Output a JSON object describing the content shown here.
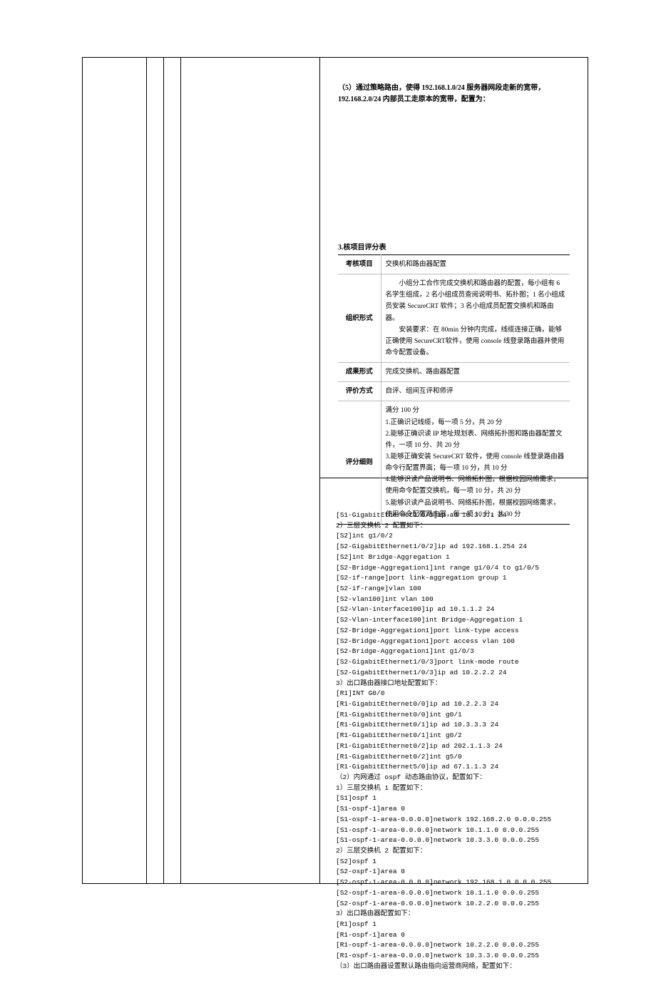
{
  "top": {
    "text": "（5）通过策略路由，使得 192.168.1.0/24 服务器网段走新的宽带，192.168.2.0/24 内部员工走原本的宽带，配置为："
  },
  "table_title": "3.核项目评分表",
  "rows": [
    {
      "h": "考核项目",
      "c": "交换机和路由器配置"
    },
    {
      "h": "组织形式",
      "c": "　　小组分工合作完成交换机和路由器的配置，每小组有 6 名学生组成，2 名小组成员查阅说明书、拓扑图；1 名小组成员安装 SecureCRT 软件；3 名小组成员配置交换机和路由器。\n　　安装要求：在 80min 分钟内完成，线缆连接正确，能够正确使用 SecureCRT软件，使用 console 线登录路由器并使用命令配置设备。"
    },
    {
      "h": "成果形式",
      "c": "完成交换机、路由器配置"
    },
    {
      "h": "评价方式",
      "c": "自评、组间互评和师评"
    },
    {
      "h": "评分细则",
      "c": "满分 100 分\n1.正确识记线缆，每一项 5 分，共 20 分\n2.能够正确识读 IP 地址规划表、网络拓扑图和路由器配置文件，一项 10 分、共 20 分\n3.能够正确安装 SecureCRT 软件，使用 console 线登录路由器命令行配置界面；每一项 10 分，共 10 分\n4.能够识读产品说明书、网络拓扑图，根据校园网络需求，使用命令配置交换机，每一项 10 分，共 20 分\n5.能够识读产品说明书、网络拓扑图，根据校园网络需求，使用命令配置路由器，每一项 10 分，共 30 分"
    }
  ],
  "code": "[S1-GigabitEthernet1/0/3]ip ad 10.3.3.1 24\n2）三层交换机 2 配置如下：\n[S2]int g1/0/2\n[S2-GigabitEthernet1/0/2]ip ad 192.168.1.254 24\n[S2]int Bridge-Aggregation 1\n[S2-Bridge-Aggregation1]int range g1/0/4 to g1/0/5\n[S2-if-range]port link-aggregation group 1\n[S2-if-range]vlan 100\n[S2-vlan100]int vlan 100\n[S2-Vlan-interface100]ip ad 10.1.1.2 24\n[S2-Vlan-interface100]int Bridge-Aggregation 1\n[S2-Bridge-Aggregation1]port link-type access\n[S2-Bridge-Aggregation1]port access vlan 100\n[S2-Bridge-Aggregation1]int g1/0/3\n[S2-GigabitEthernet1/0/3]port link-mode route\n[S2-GigabitEthernet1/0/3]ip ad 10.2.2.2 24\n3）出口路由器接口地址配置如下：\n[R1]INT G0/0\n[R1-GigabitEthernet0/0]ip ad 10.2.2.3 24\n[R1-GigabitEthernet0/0]int g0/1\n[R1-GigabitEthernet0/1]ip ad 10.3.3.3 24\n[R1-GigabitEthernet0/1]int g0/2\n[R1-GigabitEthernet0/2]ip ad 202.1.1.3 24\n[R1-GigabitEthernet0/2]int g5/0\n[R1-GigabitEthernet5/0]ip ad 67.1.1.3 24\n（2）内网通过 ospf 动态路由协议，配置如下：\n1）三层交换机 1 配置如下：\n[S1]ospf 1\n[S1-ospf-1]area 0\n[S1-ospf-1-area-0.0.0.0]network 192.168.2.0 0.0.0.255\n[S1-ospf-1-area-0.0.0.0]network 10.1.1.0 0.0.0.255\n[S1-ospf-1-area-0.0.0.0]network 10.3.3.0 0.0.0.255\n2）三层交换机 2 配置如下：\n[S2]ospf 1\n[S2-ospf-1]area 0\n[S2-ospf-1-area-0.0.0.0]network 192.168.1.0 0.0.0.255\n[S2-ospf-1-area-0.0.0.0]network 10.1.1.0 0.0.0.255\n[S2-ospf-1-area-0.0.0.0]network 10.2.2.0 0.0.0.255\n3）出口路由器配置如下：\n[R1]ospf 1\n[R1-ospf-1]area 0\n[R1-ospf-1-area-0.0.0.0]network 10.2.2.0 0.0.0.255\n[R1-ospf-1-area-0.0.0.0]network 10.3.3.0 0.0.0.255\n（3）出口路由器设置默认路由指向运营商网络，配置如下："
}
